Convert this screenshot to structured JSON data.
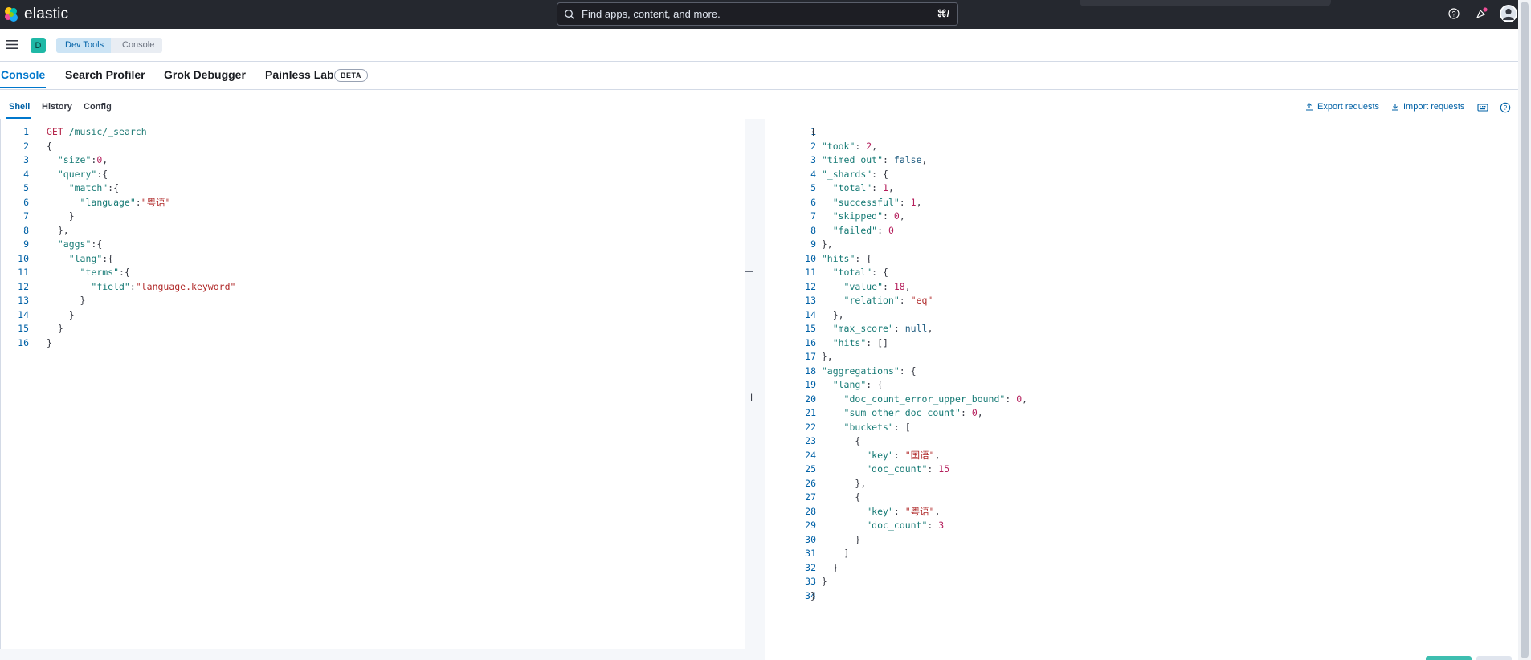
{
  "header": {
    "brand": "elastic",
    "search_placeholder": "Find apps, content, and more.",
    "search_shortcut": "⌘/"
  },
  "breadcrumb": {
    "space_initial": "D",
    "items": [
      "Dev Tools",
      "Console"
    ]
  },
  "app_tabs": [
    {
      "label": "Console",
      "active": true
    },
    {
      "label": "Search Profiler"
    },
    {
      "label": "Grok Debugger"
    },
    {
      "label": "Painless Lab",
      "badge": "BETA"
    }
  ],
  "sub_tabs": [
    {
      "label": "Shell",
      "active": true
    },
    {
      "label": "History"
    },
    {
      "label": "Config"
    }
  ],
  "toolbar": {
    "export_label": "Export requests",
    "import_label": "Import requests"
  },
  "request": {
    "lines": [
      [
        [
          "GET",
          "c-verb"
        ],
        [
          " /music/_search",
          "c-url"
        ]
      ],
      [
        [
          "{",
          "c-pun"
        ]
      ],
      [
        [
          "  ",
          "c-pun"
        ],
        [
          "\"size\"",
          "c-key"
        ],
        [
          ":",
          "c-pun"
        ],
        [
          "0",
          "c-num"
        ],
        [
          ",",
          "c-pun"
        ]
      ],
      [
        [
          "  ",
          "c-pun"
        ],
        [
          "\"query\"",
          "c-key"
        ],
        [
          ":{",
          "c-pun"
        ]
      ],
      [
        [
          "    ",
          "c-pun"
        ],
        [
          "\"match\"",
          "c-key"
        ],
        [
          ":{",
          "c-pun"
        ]
      ],
      [
        [
          "      ",
          "c-pun"
        ],
        [
          "\"language\"",
          "c-key"
        ],
        [
          ":",
          "c-pun"
        ],
        [
          "\"粤语\"",
          "c-val"
        ]
      ],
      [
        [
          "    }",
          "c-pun"
        ]
      ],
      [
        [
          "  },",
          "c-pun"
        ]
      ],
      [
        [
          "  ",
          "c-pun"
        ],
        [
          "\"aggs\"",
          "c-key"
        ],
        [
          ":{",
          "c-pun"
        ]
      ],
      [
        [
          "    ",
          "c-pun"
        ],
        [
          "\"lang\"",
          "c-key"
        ],
        [
          ":{",
          "c-pun"
        ]
      ],
      [
        [
          "      ",
          "c-pun"
        ],
        [
          "\"terms\"",
          "c-key"
        ],
        [
          ":{",
          "c-pun"
        ]
      ],
      [
        [
          "        ",
          "c-pun"
        ],
        [
          "\"field\"",
          "c-key"
        ],
        [
          ":",
          "c-pun"
        ],
        [
          "\"language.keyword\"",
          "c-val"
        ]
      ],
      [
        [
          "      }",
          "c-pun"
        ]
      ],
      [
        [
          "    }",
          "c-pun"
        ]
      ],
      [
        [
          "  }",
          "c-pun"
        ]
      ],
      [
        [
          "}",
          "c-pun"
        ]
      ]
    ]
  },
  "response": {
    "lines": [
      [
        [
          "{",
          "c-pun"
        ]
      ],
      [
        [
          "  ",
          "c-pun"
        ],
        [
          "\"took\"",
          "c-key"
        ],
        [
          ": ",
          "c-pun"
        ],
        [
          "2",
          "c-num"
        ],
        [
          ",",
          "c-pun"
        ]
      ],
      [
        [
          "  ",
          "c-pun"
        ],
        [
          "\"timed_out\"",
          "c-key"
        ],
        [
          ": ",
          "c-pun"
        ],
        [
          "false",
          "c-kw"
        ],
        [
          ",",
          "c-pun"
        ]
      ],
      [
        [
          "  ",
          "c-pun"
        ],
        [
          "\"_shards\"",
          "c-key"
        ],
        [
          ": {",
          "c-pun"
        ]
      ],
      [
        [
          "    ",
          "c-pun"
        ],
        [
          "\"total\"",
          "c-key"
        ],
        [
          ": ",
          "c-pun"
        ],
        [
          "1",
          "c-num"
        ],
        [
          ",",
          "c-pun"
        ]
      ],
      [
        [
          "    ",
          "c-pun"
        ],
        [
          "\"successful\"",
          "c-key"
        ],
        [
          ": ",
          "c-pun"
        ],
        [
          "1",
          "c-num"
        ],
        [
          ",",
          "c-pun"
        ]
      ],
      [
        [
          "    ",
          "c-pun"
        ],
        [
          "\"skipped\"",
          "c-key"
        ],
        [
          ": ",
          "c-pun"
        ],
        [
          "0",
          "c-num"
        ],
        [
          ",",
          "c-pun"
        ]
      ],
      [
        [
          "    ",
          "c-pun"
        ],
        [
          "\"failed\"",
          "c-key"
        ],
        [
          ": ",
          "c-pun"
        ],
        [
          "0",
          "c-num"
        ]
      ],
      [
        [
          "  },",
          "c-pun"
        ]
      ],
      [
        [
          "  ",
          "c-pun"
        ],
        [
          "\"hits\"",
          "c-key"
        ],
        [
          ": {",
          "c-pun"
        ]
      ],
      [
        [
          "    ",
          "c-pun"
        ],
        [
          "\"total\"",
          "c-key"
        ],
        [
          ": {",
          "c-pun"
        ]
      ],
      [
        [
          "      ",
          "c-pun"
        ],
        [
          "\"value\"",
          "c-key"
        ],
        [
          ": ",
          "c-pun"
        ],
        [
          "18",
          "c-num"
        ],
        [
          ",",
          "c-pun"
        ]
      ],
      [
        [
          "      ",
          "c-pun"
        ],
        [
          "\"relation\"",
          "c-key"
        ],
        [
          ": ",
          "c-pun"
        ],
        [
          "\"eq\"",
          "c-val"
        ]
      ],
      [
        [
          "    },",
          "c-pun"
        ]
      ],
      [
        [
          "    ",
          "c-pun"
        ],
        [
          "\"max_score\"",
          "c-key"
        ],
        [
          ": ",
          "c-pun"
        ],
        [
          "null",
          "c-kw"
        ],
        [
          ",",
          "c-pun"
        ]
      ],
      [
        [
          "    ",
          "c-pun"
        ],
        [
          "\"hits\"",
          "c-key"
        ],
        [
          ": []",
          "c-pun"
        ]
      ],
      [
        [
          "  },",
          "c-pun"
        ]
      ],
      [
        [
          "  ",
          "c-pun"
        ],
        [
          "\"aggregations\"",
          "c-key"
        ],
        [
          ": {",
          "c-pun"
        ]
      ],
      [
        [
          "    ",
          "c-pun"
        ],
        [
          "\"lang\"",
          "c-key"
        ],
        [
          ": {",
          "c-pun"
        ]
      ],
      [
        [
          "      ",
          "c-pun"
        ],
        [
          "\"doc_count_error_upper_bound\"",
          "c-key"
        ],
        [
          ": ",
          "c-pun"
        ],
        [
          "0",
          "c-num"
        ],
        [
          ",",
          "c-pun"
        ]
      ],
      [
        [
          "      ",
          "c-pun"
        ],
        [
          "\"sum_other_doc_count\"",
          "c-key"
        ],
        [
          ": ",
          "c-pun"
        ],
        [
          "0",
          "c-num"
        ],
        [
          ",",
          "c-pun"
        ]
      ],
      [
        [
          "      ",
          "c-pun"
        ],
        [
          "\"buckets\"",
          "c-key"
        ],
        [
          ": [",
          "c-pun"
        ]
      ],
      [
        [
          "        {",
          "c-pun"
        ]
      ],
      [
        [
          "          ",
          "c-pun"
        ],
        [
          "\"key\"",
          "c-key"
        ],
        [
          ": ",
          "c-pun"
        ],
        [
          "\"国语\"",
          "c-val"
        ],
        [
          ",",
          "c-pun"
        ]
      ],
      [
        [
          "          ",
          "c-pun"
        ],
        [
          "\"doc_count\"",
          "c-key"
        ],
        [
          ": ",
          "c-pun"
        ],
        [
          "15",
          "c-num"
        ]
      ],
      [
        [
          "        },",
          "c-pun"
        ]
      ],
      [
        [
          "        {",
          "c-pun"
        ]
      ],
      [
        [
          "          ",
          "c-pun"
        ],
        [
          "\"key\"",
          "c-key"
        ],
        [
          ": ",
          "c-pun"
        ],
        [
          "\"粤语\"",
          "c-val"
        ],
        [
          ",",
          "c-pun"
        ]
      ],
      [
        [
          "          ",
          "c-pun"
        ],
        [
          "\"doc_count\"",
          "c-key"
        ],
        [
          ": ",
          "c-pun"
        ],
        [
          "3",
          "c-num"
        ]
      ],
      [
        [
          "        }",
          "c-pun"
        ]
      ],
      [
        [
          "      ]",
          "c-pun"
        ]
      ],
      [
        [
          "    }",
          "c-pun"
        ]
      ],
      [
        [
          "  }",
          "c-pun"
        ]
      ],
      [
        [
          "}",
          "c-pun"
        ]
      ]
    ]
  },
  "colors": {
    "header_bg": "#25282f",
    "accent": "#0077cc",
    "space_badge": "#1fb8a6"
  }
}
